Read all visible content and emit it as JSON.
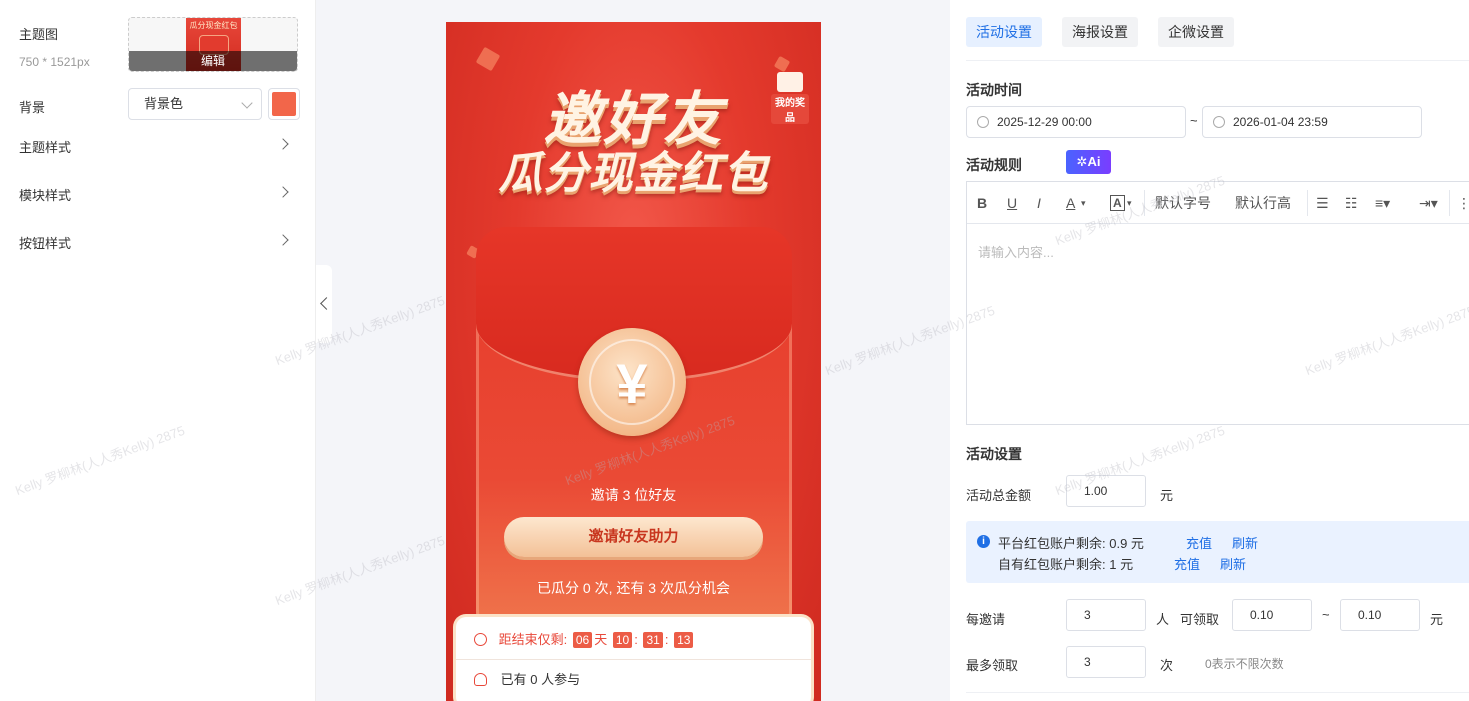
{
  "left_panel": {
    "theme_image_label": "主题图",
    "theme_image_size": "750 * 1521px",
    "theme_image_thumb_text": "瓜分现金红包",
    "edit_label": "编辑",
    "background_label": "背景",
    "background_select_value": "背景色",
    "background_color": "#f2664a",
    "rows": [
      {
        "label": "主题样式"
      },
      {
        "label": "模块样式"
      },
      {
        "label": "按钮样式"
      }
    ]
  },
  "preview": {
    "title_line1": "邀好友",
    "title_line2": "瓜分现金红包",
    "prize_label": "我的奖品",
    "coin_symbol": "¥",
    "invite_text": "邀请 3 位好友",
    "invite_button": "邀请好友助力",
    "shared_text": "已瓜分 0 次, 还有 3 次瓜分机会",
    "countdown_label": "距结束仅剩:",
    "countdown": {
      "days": "06",
      "day_unit": "天",
      "hours": "10",
      "minutes": "31",
      "seconds": "13",
      "sep": ":"
    },
    "participants_text": "已有 0 人参与",
    "accent_color": "#e43a2d"
  },
  "right_panel": {
    "tabs": [
      {
        "label": "活动设置",
        "active": true
      },
      {
        "label": "海报设置",
        "active": false
      },
      {
        "label": "企微设置",
        "active": false
      }
    ],
    "activity_time_label": "活动时间",
    "start_time": "2025-12-29 00:00",
    "range_sep": "~",
    "end_time": "2026-01-04 23:59",
    "rules_label": "活动规则",
    "ai_button": "✲Ai",
    "toolbar": {
      "bold": "B",
      "underline": "U",
      "italic": "I",
      "font_color": "A",
      "bg_color": "A",
      "font_size": "默认字号",
      "line_height": "默认行高"
    },
    "editor_placeholder": "请输入内容...",
    "settings_label": "活动设置",
    "total_amount_label": "活动总金额",
    "total_amount_value": "1.00",
    "yuan_unit": "元",
    "platform_balance": "平台红包账户剩余: 0.9 元",
    "own_balance": "自有红包账户剩余: 1 元",
    "recharge_link": "充值",
    "refresh_link": "刷新",
    "per_invite_label": "每邀请",
    "per_invite_value": "3",
    "person_unit": "人",
    "can_receive_label": "可领取",
    "min_amount": "0.10",
    "max_amount": "0.10",
    "max_receive_label": "最多领取",
    "max_receive_value": "3",
    "times_unit": "次",
    "unlimited_hint": "0表示不限次数",
    "link_color": "#1f6fe5"
  },
  "watermark": "Kelly 罗柳林(人人秀Kelly) 2875"
}
